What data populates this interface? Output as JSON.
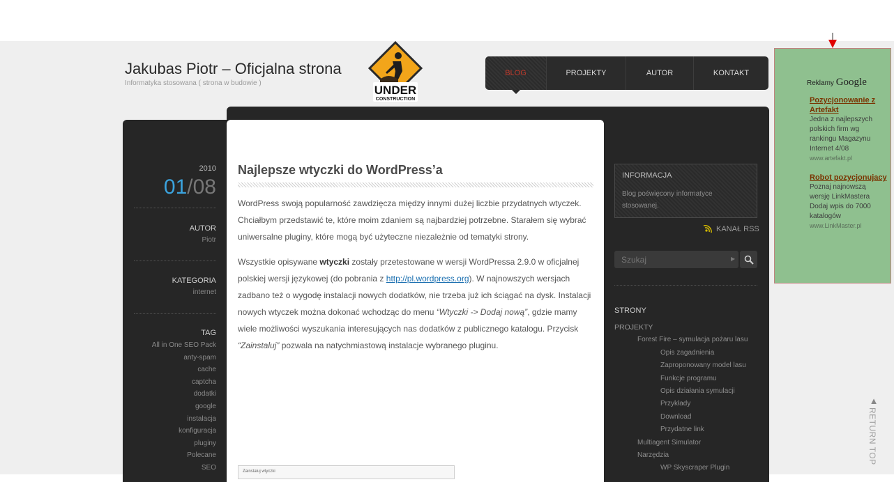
{
  "header": {
    "title": "Jakubas Piotr – Oficjalna strona",
    "tagline": "Informatyka stosowana ( strona w budowie )",
    "badge": {
      "line1": "UNDER",
      "line2": "CONSTRUCTION",
      "icon": "under-construction-sign"
    }
  },
  "nav": {
    "items": [
      {
        "label": "BLOG",
        "active": true
      },
      {
        "label": "PROJEKTY",
        "active": false
      },
      {
        "label": "AUTOR",
        "active": false
      },
      {
        "label": "KONTAKT",
        "active": false
      }
    ]
  },
  "post": {
    "year": "2010",
    "day": "01",
    "month": "08",
    "slash": "/",
    "author_label": "AUTOR",
    "author": "Piotr",
    "category_label": "KATEGORIA",
    "category": "internet",
    "tag_label": "TAG",
    "tags": [
      "All in One SEO Pack",
      "anty-spam",
      "cache",
      "captcha",
      "dodatki",
      "google",
      "instalacja",
      "konfiguracja",
      "pluginy",
      "Polecane",
      "SEO"
    ],
    "title": "Najlepsze wtyczki do WordPress’a",
    "p1": "WordPress swoją popularność zawdzięcza między innymi dużej liczbie przydatnych wtyczek. Chciałbym przedstawić te, które moim zdaniem są najbardziej potrzebne. Starałem się wybrać uniwersalne pluginy, które mogą być użyteczne niezależnie od tematyki strony.",
    "p2_a": "Wszystkie opisywane ",
    "p2_bold": "wtyczki",
    "p2_b": " zostały przetestowane w wersji WordPressa 2.9.0 w oficjalnej polskiej wersji językowej (do pobrania z ",
    "p2_link": "http://pl.wordpress.org",
    "p2_c": ").  W najnowszych wersjach zadbano też o wygodę instalacji nowych dodatków, nie trzeba już ich ściągać na dysk. Instalacji nowych wtyczek można dokonać wchodząc do menu ",
    "p2_em1": "“Wtyczki -> Dodaj nową”",
    "p2_d": ", gdzie mamy wiele możliwości wyszukania interesujących nas dodatków z publicznego katalogu. Przycisk ",
    "p2_em2": "“Zainstaluj”",
    "p2_e": " pozwala na natychmiastową instalacje wybranego pluginu.",
    "thumb_caption": "Zainstaluj wtyczki"
  },
  "sidebar": {
    "info_title": "INFORMACJA",
    "info_text": "Blog poświęcony informatyce stosowanej.",
    "rss_label": "KANAŁ RSS",
    "search_placeholder": "Szukaj",
    "pages_heading": "STRONY",
    "pages": [
      {
        "label": "PROJEKTY",
        "level": 0
      },
      {
        "label": "Forest Fire – symulacja pożaru lasu",
        "level": 1
      },
      {
        "label": "Opis zagadnienia",
        "level": 2
      },
      {
        "label": "Zaproponowany model lasu",
        "level": 2
      },
      {
        "label": "Funkcje programu",
        "level": 2
      },
      {
        "label": "Opis działania symulacji",
        "level": 2
      },
      {
        "label": "Przykłady",
        "level": 2
      },
      {
        "label": "Download",
        "level": 2
      },
      {
        "label": "Przydatne link",
        "level": 2
      },
      {
        "label": "Multiagent Simulator",
        "level": 1
      },
      {
        "label": "Narzędzia",
        "level": 1
      },
      {
        "label": "WP Skyscraper Plugin",
        "level": 2
      }
    ]
  },
  "ads": {
    "brand_prefix": "Reklamy",
    "brand": "Google",
    "items": [
      {
        "title": "Pozycjonowanie z Artefakt",
        "body": "Jedna z najlepszych polskich firm wg rankingu Magazynu Internet 4/08",
        "url": "www.artefakt.pl"
      },
      {
        "title": "Robot pozycjonujacy",
        "body": "Poznaj najnowszą wersję LinkMastera Dodaj wpis do 7000 katalogów",
        "url": "www.LinkMaster.pl"
      }
    ]
  },
  "return_top": {
    "label": "RETURN TOP",
    "arrow": "▲"
  },
  "colors": {
    "accent": "#3ba3de",
    "nav_active": "#c0392b",
    "ad_bg": "#8fc08f",
    "dark": "#262626"
  }
}
